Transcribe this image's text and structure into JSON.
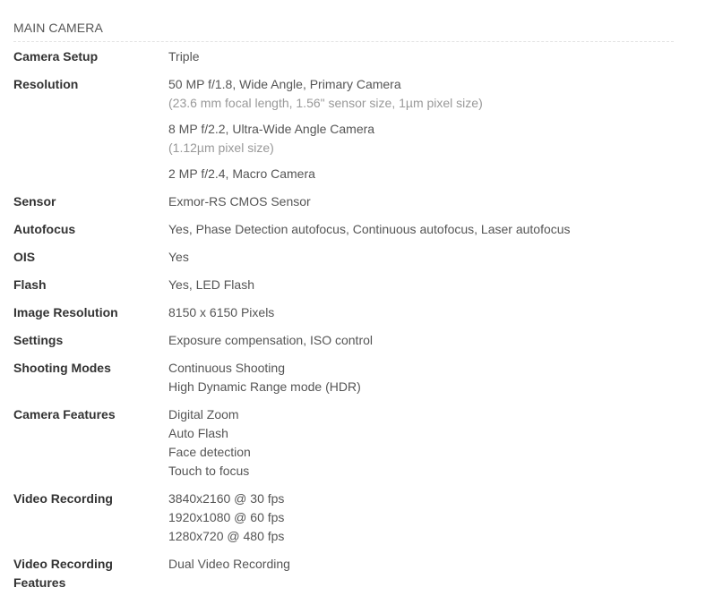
{
  "section": {
    "title": "MAIN CAMERA"
  },
  "rows": [
    {
      "label": "Camera Setup",
      "groups": [
        {
          "lines": [
            "Triple"
          ]
        }
      ]
    },
    {
      "label": "Resolution",
      "groups": [
        {
          "lines": [
            "50 MP f/1.8, Wide Angle, Primary Camera"
          ],
          "sub": "(23.6 mm focal length, 1.56\" sensor size, 1µm pixel size)"
        },
        {
          "lines": [
            "8 MP f/2.2, Ultra-Wide Angle Camera"
          ],
          "sub": "(1.12µm pixel size)"
        },
        {
          "lines": [
            "2 MP f/2.4, Macro Camera"
          ]
        }
      ]
    },
    {
      "label": "Sensor",
      "groups": [
        {
          "lines": [
            "Exmor-RS CMOS Sensor"
          ]
        }
      ]
    },
    {
      "label": "Autofocus",
      "groups": [
        {
          "lines": [
            "Yes, Phase Detection autofocus, Continuous autofocus, Laser autofocus"
          ]
        }
      ]
    },
    {
      "label": "OIS",
      "groups": [
        {
          "lines": [
            "Yes"
          ]
        }
      ]
    },
    {
      "label": "Flash",
      "groups": [
        {
          "lines": [
            "Yes, LED Flash"
          ]
        }
      ]
    },
    {
      "label": "Image Resolution",
      "groups": [
        {
          "lines": [
            "8150 x 6150 Pixels"
          ]
        }
      ]
    },
    {
      "label": "Settings",
      "groups": [
        {
          "lines": [
            "Exposure compensation, ISO control"
          ]
        }
      ]
    },
    {
      "label": "Shooting Modes",
      "groups": [
        {
          "lines": [
            "Continuous Shooting",
            "High Dynamic Range mode (HDR)"
          ]
        }
      ]
    },
    {
      "label": "Camera Features",
      "groups": [
        {
          "lines": [
            "Digital Zoom",
            "Auto Flash",
            "Face detection",
            "Touch to focus"
          ]
        }
      ]
    },
    {
      "label": "Video Recording",
      "groups": [
        {
          "lines": [
            "3840x2160 @ 30 fps",
            "1920x1080 @ 60 fps",
            "1280x720 @ 480 fps"
          ]
        }
      ]
    },
    {
      "label": "Video Recording Features",
      "groups": [
        {
          "lines": [
            "Dual Video Recording"
          ]
        }
      ]
    }
  ]
}
